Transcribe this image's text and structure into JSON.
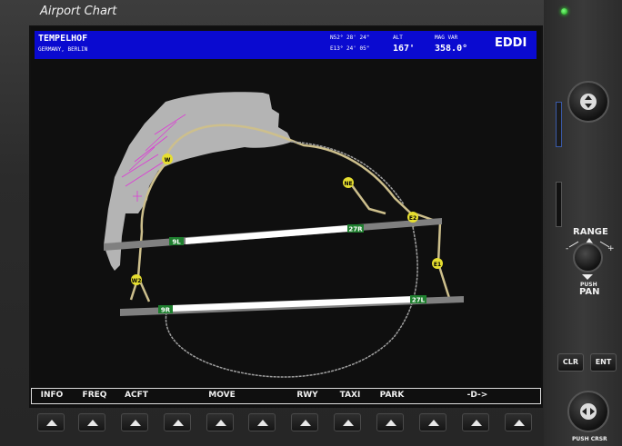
{
  "window": {
    "title": "Airport Chart"
  },
  "header": {
    "airport_name": "TEMPELHOF",
    "location": "GERMANY, BERLIN",
    "lat": "N52° 28' 24\"",
    "lon": "E13° 24' 05\"",
    "alt_label": "ALT",
    "alt_value": "167'",
    "magvar_label": "MAG VAR",
    "magvar_value": "358.0°",
    "icao": "EDDI"
  },
  "map": {
    "taxiways": [
      "W",
      "NE",
      "E2",
      "E1",
      "W2"
    ],
    "runway_labels": [
      "9L",
      "27R",
      "9R",
      "27L"
    ],
    "colors": {
      "ground": "#b4b4b4",
      "taxi": "#cdbf8c",
      "runway": "#ffffff",
      "marker": "#e6de30",
      "label_bg": "#1f7f2f",
      "parking": "#dd3ad6"
    }
  },
  "softkeys": [
    "INFO",
    "FREQ",
    "ACFT",
    "MOVE",
    "RWY",
    "TAXI",
    "PARK",
    "-D->"
  ],
  "controls": {
    "range_label": "RANGE",
    "push_pan_small": "PUSH",
    "push_pan": "PAN",
    "clr": "CLR",
    "ent": "ENT",
    "push_crsr": "PUSH CRSR"
  }
}
